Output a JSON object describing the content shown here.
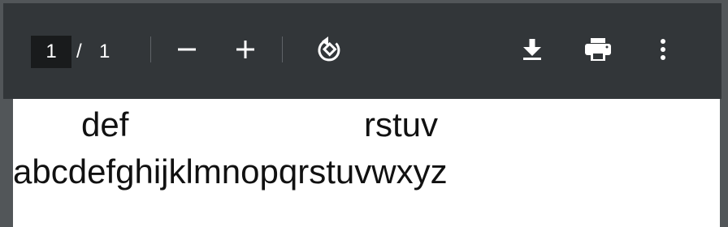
{
  "toolbar": {
    "page_current": "1",
    "page_separator": "/",
    "page_total": "1",
    "icons": {
      "zoom_out": "minus-icon",
      "zoom_in": "plus-icon",
      "rotate": "rotate-icon",
      "download": "download-icon",
      "print": "print-icon",
      "more": "more-vert-icon"
    }
  },
  "document": {
    "line1_left": "def",
    "line1_right": "rstuv",
    "line2": "abcdefghijklmnopqrstuvwxyz"
  },
  "colors": {
    "toolbar_bg": "#323639",
    "viewer_bg": "#525659",
    "page_bg": "#ffffff",
    "page_box_bg": "#191b1c",
    "icon": "#ffffff"
  }
}
